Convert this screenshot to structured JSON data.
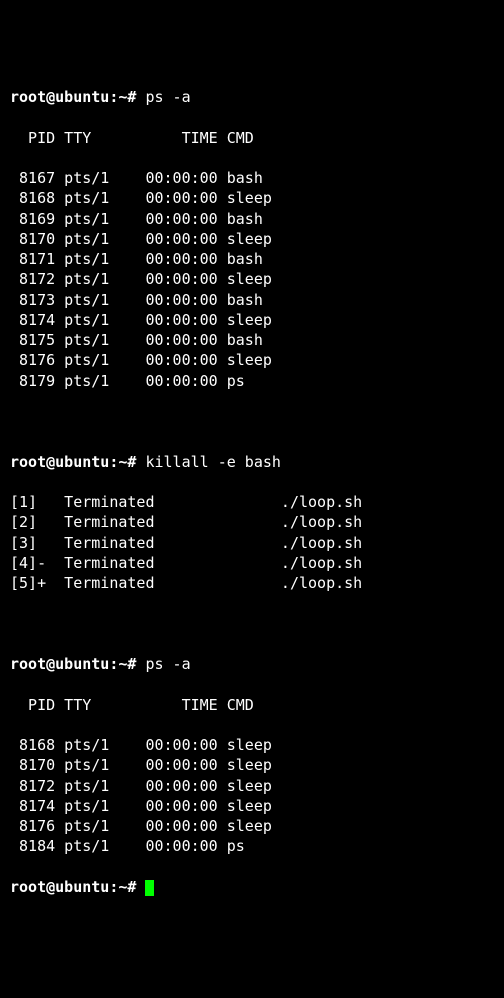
{
  "prompt": "root@ubuntu:~#",
  "cmd1": "ps -a",
  "header1": "  PID TTY          TIME CMD",
  "rows1": [
    " 8167 pts/1    00:00:00 bash",
    " 8168 pts/1    00:00:00 sleep",
    " 8169 pts/1    00:00:00 bash",
    " 8170 pts/1    00:00:00 sleep",
    " 8171 pts/1    00:00:00 bash",
    " 8172 pts/1    00:00:00 sleep",
    " 8173 pts/1    00:00:00 bash",
    " 8174 pts/1    00:00:00 sleep",
    " 8175 pts/1    00:00:00 bash",
    " 8176 pts/1    00:00:00 sleep",
    " 8179 pts/1    00:00:00 ps"
  ],
  "cmd2": "killall -e bash",
  "jobs": [
    "[1]   Terminated              ./loop.sh",
    "[2]   Terminated              ./loop.sh",
    "[3]   Terminated              ./loop.sh",
    "[4]-  Terminated              ./loop.sh",
    "[5]+  Terminated              ./loop.sh"
  ],
  "cmd3": "ps -a",
  "header2": "  PID TTY          TIME CMD",
  "rows2": [
    " 8168 pts/1    00:00:00 sleep",
    " 8170 pts/1    00:00:00 sleep",
    " 8172 pts/1    00:00:00 sleep",
    " 8174 pts/1    00:00:00 sleep",
    " 8176 pts/1    00:00:00 sleep",
    " 8184 pts/1    00:00:00 ps"
  ]
}
